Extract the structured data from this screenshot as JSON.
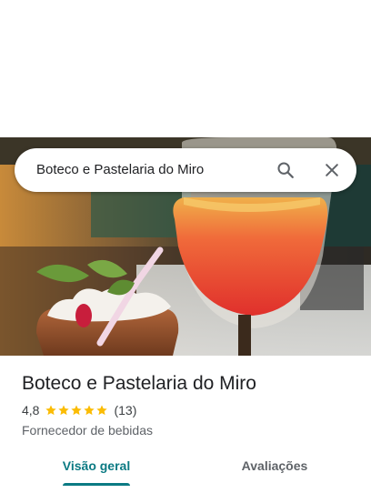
{
  "search": {
    "query": "Boteco e Pastelaria do Miro",
    "search_icon": "search-icon",
    "close_icon": "close-icon"
  },
  "hero": {
    "image_subject": "photo"
  },
  "place": {
    "title": "Boteco e Pastelaria do Miro",
    "rating": "4,8",
    "rating_value": 4.8,
    "stars_max": 5,
    "review_count": "(13)",
    "category": "Fornecedor de bebidas"
  },
  "tabs": [
    {
      "label": "Visão geral",
      "active": true
    },
    {
      "label": "Avaliações",
      "active": false
    }
  ],
  "colors": {
    "accent": "#0b7a83",
    "star": "#fbbc04",
    "text_primary": "#202124",
    "text_secondary": "#5f6368"
  }
}
